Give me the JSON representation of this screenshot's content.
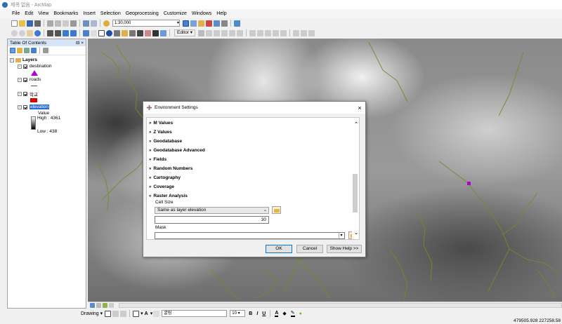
{
  "window": {
    "title": "제목 없음 - ArcMap"
  },
  "menu": [
    "File",
    "Edit",
    "View",
    "Bookmarks",
    "Insert",
    "Selection",
    "Geoprocessing",
    "Customize",
    "Windows",
    "Help"
  ],
  "toolbar": {
    "scale": "1:30,000",
    "editor_label": "Editor"
  },
  "toc": {
    "title": "Table Of Contents",
    "pin": "⊟",
    "close": "×",
    "layers_group": "Layers",
    "layers": [
      {
        "name": "destination",
        "symbol": "purple-triangle"
      },
      {
        "name": "roads",
        "symbol": "dark-line"
      },
      {
        "name": "학교",
        "symbol": "red-rectangle"
      },
      {
        "name": "elevation",
        "symbol": "grayscale-ramp"
      }
    ],
    "elevation_legend": {
      "value_label": "Value",
      "high": "High : 4361",
      "low": "Low : 438"
    }
  },
  "dialog": {
    "title": "Environment Settings",
    "close": "×",
    "sections": [
      "M Values",
      "Z Values",
      "Geodatabase",
      "Geodatabase Advanced",
      "Fields",
      "Random Numbers",
      "Cartography",
      "Coverage",
      "Raster Analysis"
    ],
    "cell_size_label": "Cell Size",
    "cell_size_option": "Same as layer elevation",
    "cell_size_value": "30",
    "mask_label": "Mask",
    "mask_value": "",
    "buttons": {
      "ok": "OK",
      "cancel": "Cancel",
      "help": "Show Help >>"
    }
  },
  "drawing": {
    "label": "Drawing",
    "font": "굴림",
    "size": "10",
    "bold": "B",
    "italic": "I",
    "underline": "U"
  },
  "status": {
    "coordinates": "479505.928  227258.58"
  },
  "colors": {
    "road": "#6b8f2a",
    "destination": "#b000d0",
    "school": "#d40000",
    "accent": "#2a6bd1"
  }
}
